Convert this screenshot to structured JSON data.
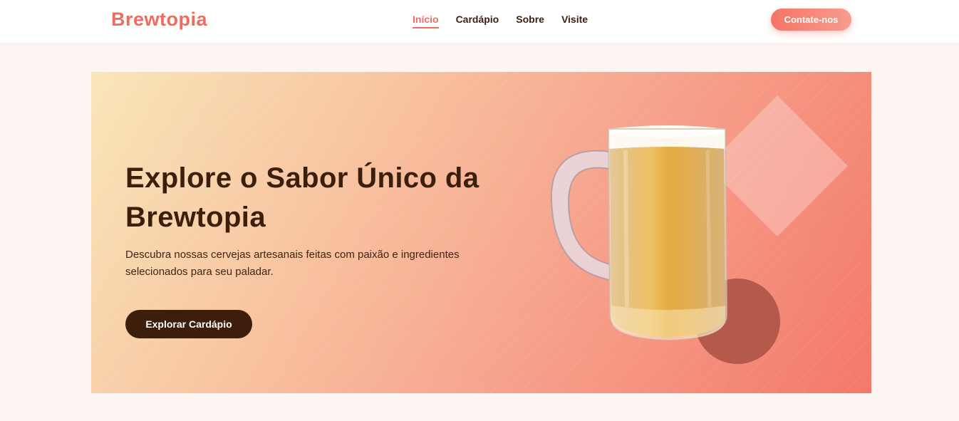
{
  "brand": {
    "name": "Brewtopia",
    "color": "#f06c5e"
  },
  "nav": {
    "links": [
      {
        "label": "Início",
        "active": true
      },
      {
        "label": "Cardápio",
        "active": false
      },
      {
        "label": "Sobre",
        "active": false
      },
      {
        "label": "Visite",
        "active": false
      }
    ],
    "contact_label": "Contate-nos"
  },
  "hero": {
    "title": "Explore o Sabor Único da Brewtopia",
    "subtitle": "Descubra nossas cervejas artesanais feitas com paixão e ingredientes selecionados para seu paladar.",
    "cta_label": "Explorar Cardápio",
    "image": "beer-mug-illustration",
    "colors": {
      "text_dark": "#3b1f0c",
      "button_dark": "#3d1d0b",
      "accent_circle": "#b55a4a"
    }
  }
}
